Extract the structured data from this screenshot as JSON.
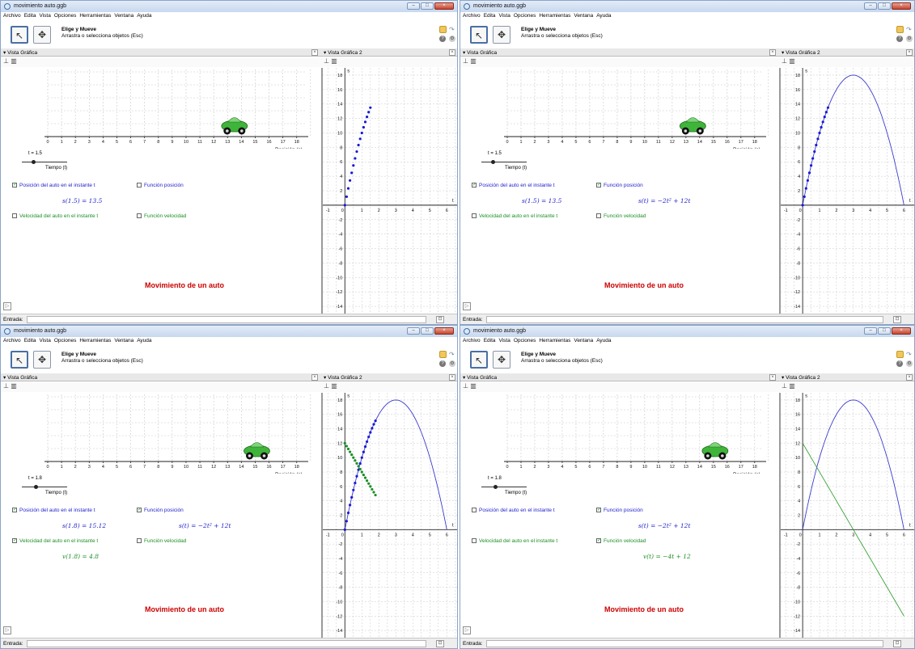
{
  "app": {
    "window_title": "movimiento auto.ggb",
    "menu": [
      "Archivo",
      "Edita",
      "Vista",
      "Opciones",
      "Herramientas",
      "Ventana",
      "Ayuda"
    ],
    "tool_name": "Elige y Mueve",
    "tool_desc": "Arrastra o selecciona objetos (Esc)",
    "view1": "Vista Gráfica",
    "view2": "Vista Gráfica 2",
    "input_label": "Entrada:",
    "win_min": "–",
    "win_max": "□",
    "win_close": "×"
  },
  "labels": {
    "slider_title": "Tiempo (t)",
    "pos_axis": "Posición (s)",
    "cb_position": "Posición del auto en el instante t",
    "cb_velocity": "Velocidad del auto en el instante t",
    "cb_pos_func": "Función posición",
    "cb_vel_func": "Función velocidad",
    "title": "Movimiento de un auto",
    "pos_func_expr": "s(t) = −2t² + 12t",
    "vel_func_expr": "v(t) = −4t + 12",
    "axis_s": "s",
    "axis_t": "t",
    "checkmark": "✓"
  },
  "ticks": {
    "pos_axis": [
      "0",
      "1",
      "2",
      "3",
      "4",
      "5",
      "6",
      "7",
      "8",
      "9",
      "10",
      "11",
      "12",
      "13",
      "14",
      "15",
      "16",
      "17",
      "18"
    ],
    "graph_x": [
      "-1",
      "0",
      "1",
      "2",
      "3",
      "4",
      "5",
      "6"
    ],
    "graph_y": [
      "18",
      "16",
      "14",
      "12",
      "10",
      "8",
      "6",
      "4",
      "2",
      "0",
      "-2",
      "-4",
      "-6",
      "-8",
      "-10",
      "-12",
      "-14"
    ]
  },
  "panels": [
    {
      "slider_label": "t = 1.5",
      "t": 1.5,
      "car_s": 13.5,
      "pos_value": "s(1.5) = 13.5",
      "vel_value": "",
      "show_pos": true,
      "show_vel": false,
      "show_pos_func": false,
      "show_vel_func": false,
      "show_pos_dots": true,
      "show_vel_dots": false
    },
    {
      "slider_label": "t = 1.5",
      "t": 1.5,
      "car_s": 13.5,
      "pos_value": "s(1.5) = 13.5",
      "vel_value": "",
      "show_pos": true,
      "show_vel": false,
      "show_pos_func": true,
      "show_vel_func": false,
      "show_pos_dots": true,
      "show_vel_dots": false
    },
    {
      "slider_label": "t = 1.8",
      "t": 1.8,
      "car_s": 15.12,
      "pos_value": "s(1.8) = 15.12",
      "vel_value": "v(1.8) = 4.8",
      "show_pos": true,
      "show_vel": true,
      "show_pos_func": true,
      "show_vel_func": false,
      "show_pos_dots": true,
      "show_vel_dots": true
    },
    {
      "slider_label": "t = 1.8",
      "t": 1.8,
      "car_s": 15.12,
      "pos_value": "",
      "vel_value": "",
      "show_pos": false,
      "show_vel": false,
      "show_pos_func": true,
      "show_vel_func": true,
      "show_pos_dots": false,
      "show_vel_dots": false
    }
  ],
  "chart_data": {
    "type": "line",
    "xlim": [
      -1.3,
      6.7
    ],
    "ylim": [
      -15,
      19
    ],
    "x_ticks": [
      -1,
      0,
      1,
      2,
      3,
      4,
      5,
      6
    ],
    "y_ticks": [
      -14,
      -12,
      -10,
      -8,
      -6,
      -4,
      -2,
      2,
      4,
      6,
      8,
      10,
      12,
      14,
      16,
      18
    ],
    "xlabel": "t",
    "ylabel": "s",
    "series": [
      {
        "name": "s(t)",
        "formula": "s(t) = −2t² + 12t",
        "domain": [
          0,
          6
        ],
        "color": "#3a3ad0"
      },
      {
        "name": "v(t)",
        "formula": "v(t) = −4t + 12",
        "domain": [
          0,
          6
        ],
        "color": "#3aa33a"
      }
    ]
  },
  "colors": {
    "pos": "#2222cc",
    "vel": "#1b8f25",
    "title": "#cc0000",
    "grid": "#c8c8c8"
  }
}
